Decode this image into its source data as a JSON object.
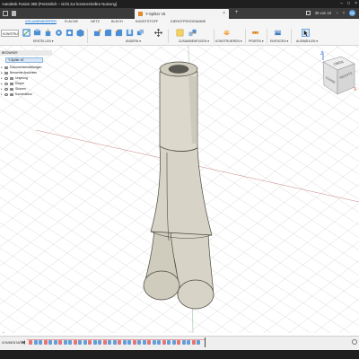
{
  "window": {
    "title": "Autodesk Fusion 360 (Persönlich – nicht zur kommerziellen Nutzung)",
    "buttons": [
      "–",
      "□",
      "×"
    ]
  },
  "doc_tab": {
    "label": "Y-Spliter v5",
    "close": "×",
    "new_tab": "+"
  },
  "account": {
    "badge": "35 von 10",
    "avatar": "SB"
  },
  "workspace_tabs": [
    "VOLUMENKÖRPER",
    "FLÄCHE",
    "NETZ",
    "BLECH",
    "KUNSTSTOFF",
    "DIENSTPROGRAMME"
  ],
  "workspace_active": "VOLUMENKÖRPER",
  "toolbar": {
    "design_label": "KONSTRUKTION ▾",
    "groups": [
      "ERSTELLEN ▾",
      "ÄNDERN ▾",
      "ZUSAMMENFÜGEN ▾",
      "KONSTRUIEREN ▾",
      "PRÜFEN ▾",
      "EINFÜGEN ▾",
      "AUSWÄHLEN ▾"
    ]
  },
  "browser": {
    "header": "BROWSER",
    "root": "Y-Spliter v5",
    "items": [
      "Dokumenteinstellungen",
      "Benannte Ansichten",
      "Ursprung",
      "Körper",
      "Skizzen",
      "Konstruktion"
    ]
  },
  "viewcube": {
    "front": "VORNE",
    "right": "RECHTS",
    "top": "OBEN",
    "axis_z": "Z",
    "axis_x": "X"
  },
  "timeline": {
    "label": "KOMMENTARE",
    "items": 35
  },
  "colors": {
    "accent": "#0b6bcb",
    "model_fill": "#d7d3c6",
    "model_edge": "#4a4a40",
    "grid": "#c9c9c9",
    "timeline_sketch": "#e34b4b",
    "timeline_feature": "#4a8fd6"
  }
}
